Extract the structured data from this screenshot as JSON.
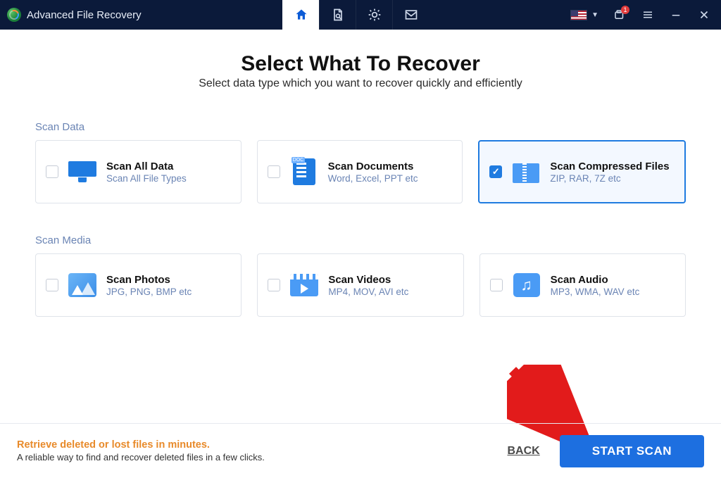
{
  "app": {
    "title": "Advanced File Recovery"
  },
  "titlebar": {
    "notification_count": "1"
  },
  "page": {
    "heading": "Select What To Recover",
    "subtitle": "Select data type which you want to recover quickly and efficiently"
  },
  "sections": {
    "data": {
      "label": "Scan Data",
      "cards": [
        {
          "title": "Scan All Data",
          "sub": "Scan All File Types"
        },
        {
          "title": "Scan Documents",
          "sub": "Word, Excel, PPT etc"
        },
        {
          "title": "Scan Compressed Files",
          "sub": "ZIP, RAR, 7Z etc"
        }
      ]
    },
    "media": {
      "label": "Scan Media",
      "cards": [
        {
          "title": "Scan Photos",
          "sub": "JPG, PNG, BMP etc"
        },
        {
          "title": "Scan Videos",
          "sub": "MP4, MOV, AVI etc"
        },
        {
          "title": "Scan Audio",
          "sub": "MP3, WMA, WAV etc"
        }
      ]
    }
  },
  "footer": {
    "headline": "Retrieve deleted or lost files in minutes.",
    "sub": "A reliable way to find and recover deleted files in a few clicks.",
    "back": "BACK",
    "start": "START SCAN"
  }
}
